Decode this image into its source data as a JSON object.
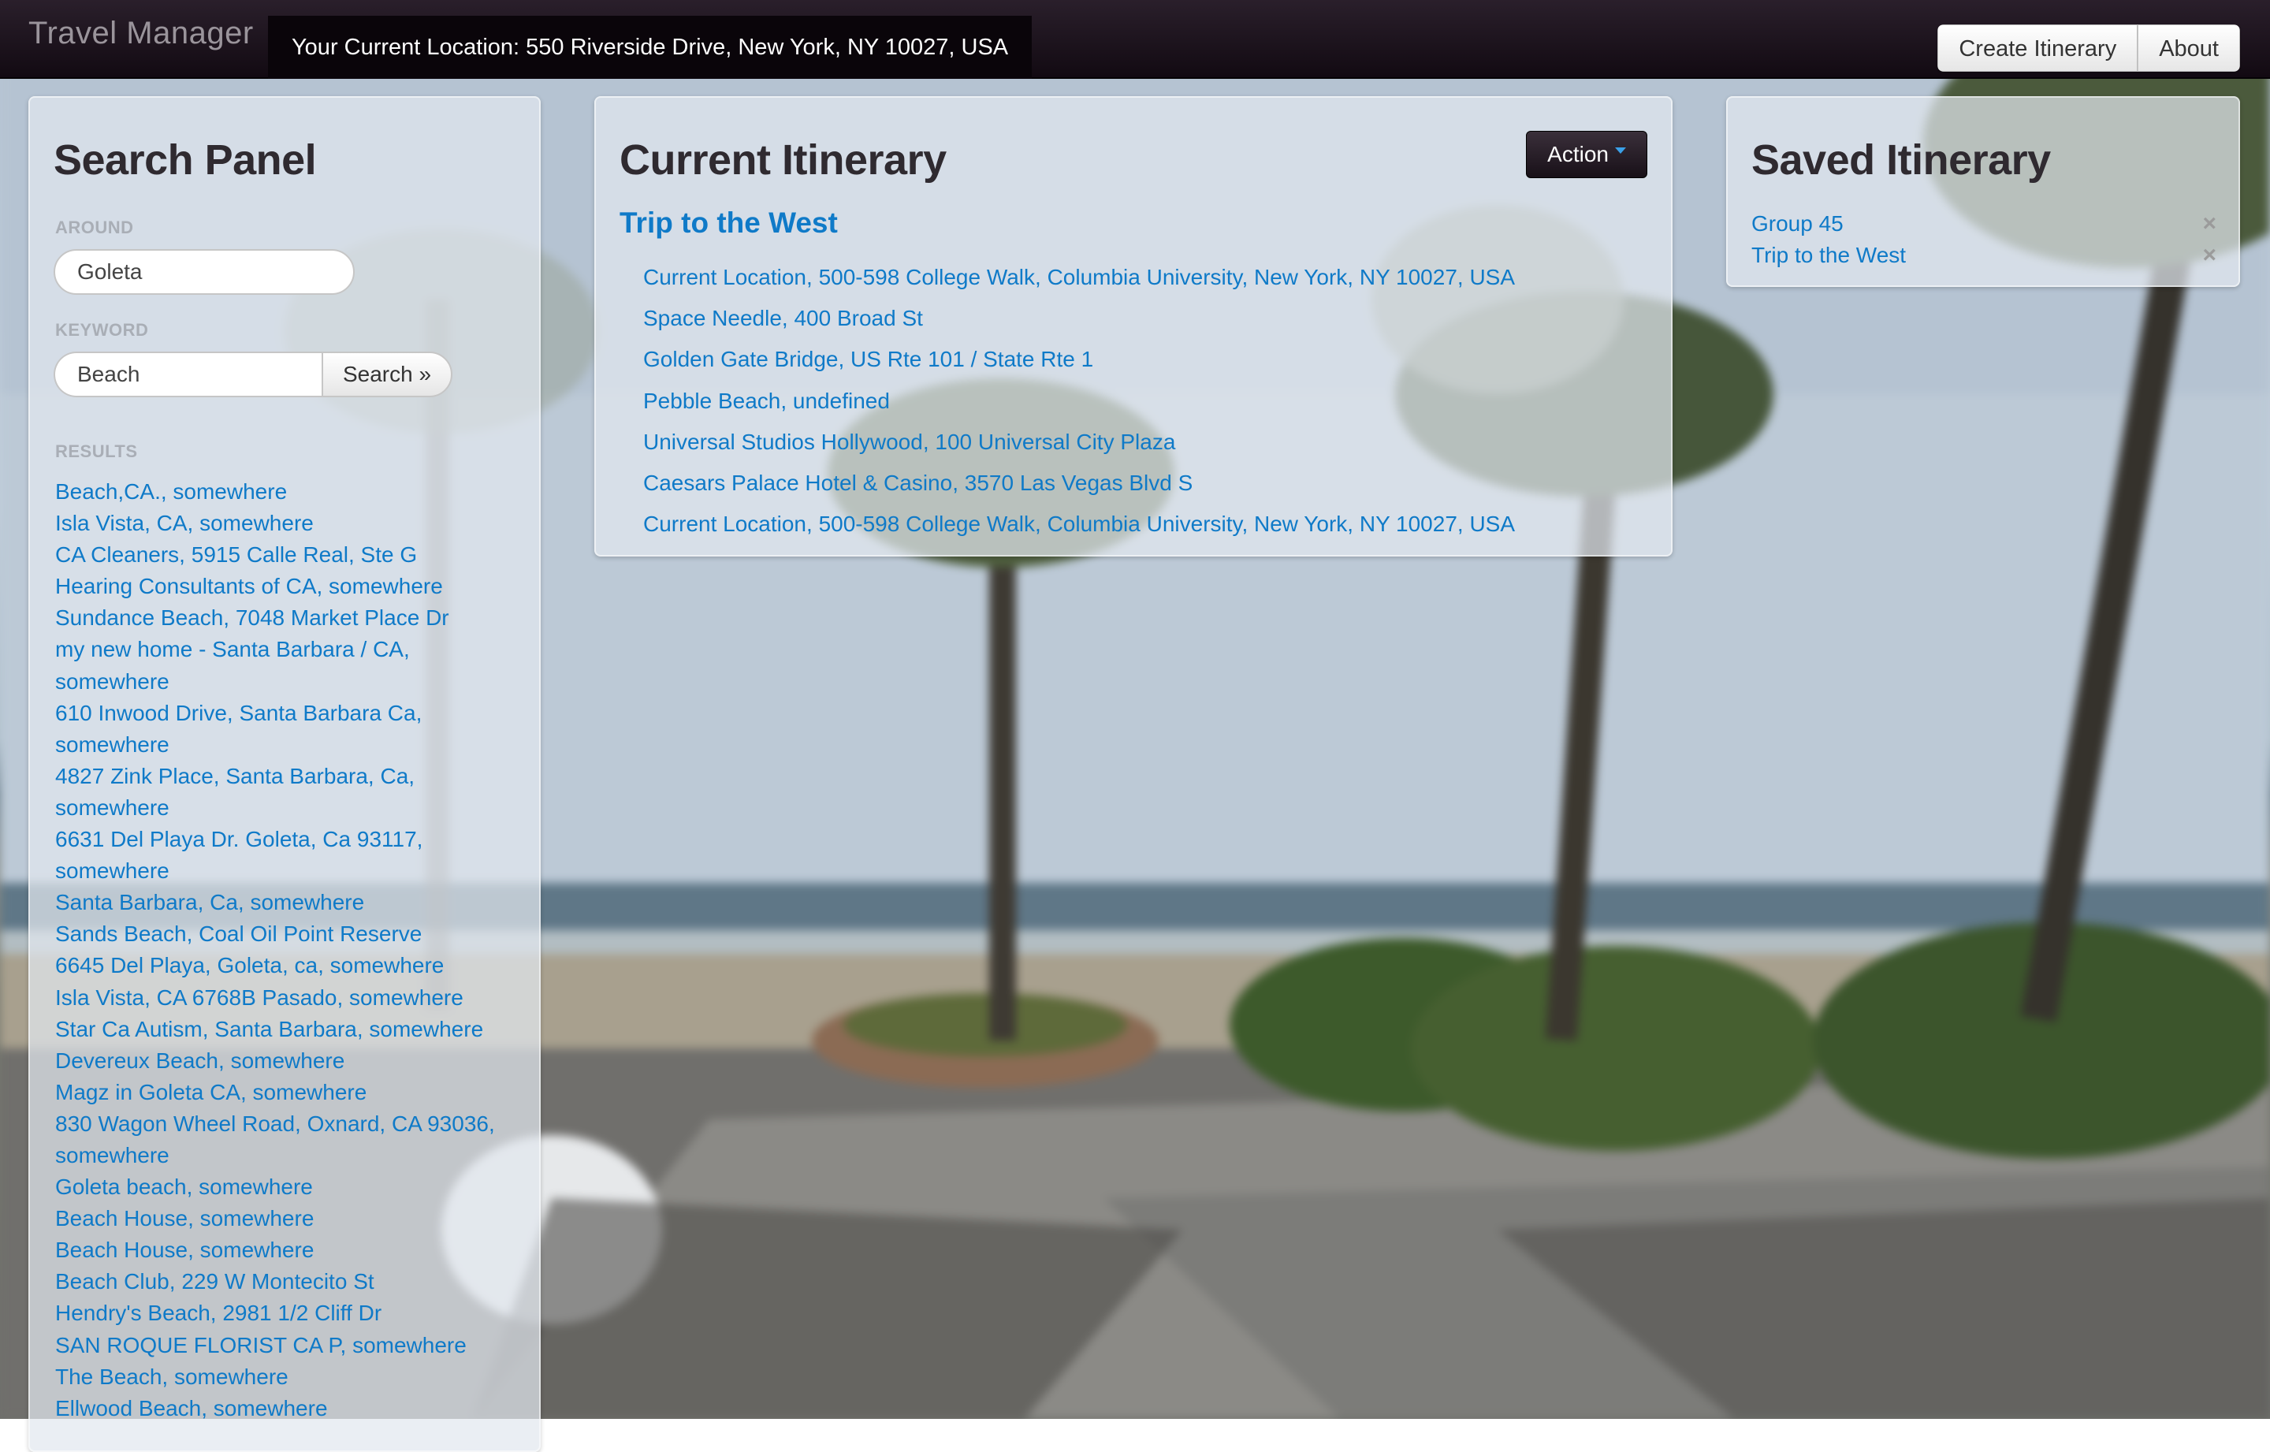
{
  "navbar": {
    "brand": "Travel Manager",
    "location": "Your Current Location: 550 Riverside Drive, New York, NY 10027, USA",
    "buttons": {
      "create_itinerary": "Create Itinerary",
      "about": "About"
    }
  },
  "search_panel": {
    "title": "Search Panel",
    "around_label": "AROUND",
    "around_value": "Goleta",
    "keyword_label": "KEYWORD",
    "keyword_value": "Beach",
    "search_button": "Search »",
    "results_label": "RESULTS",
    "results": [
      "Beach,CA., somewhere",
      "Isla Vista, CA, somewhere",
      "CA Cleaners, 5915 Calle Real, Ste G",
      "Hearing Consultants of CA, somewhere",
      "Sundance Beach, 7048 Market Place Dr",
      "my new home - Santa Barbara / CA, somewhere",
      "610 Inwood Drive, Santa Barbara Ca, somewhere",
      "4827 Zink Place, Santa Barbara, Ca, somewhere",
      "6631 Del Playa Dr. Goleta, Ca 93117, somewhere",
      "Santa Barbara, Ca, somewhere",
      "Sands Beach, Coal Oil Point Reserve",
      "6645 Del Playa, Goleta, ca, somewhere",
      "Isla Vista, CA 6768B Pasado, somewhere",
      "Star Ca Autism, Santa Barbara, somewhere",
      "Devereux Beach, somewhere",
      "Magz in Goleta CA, somewhere",
      "830 Wagon Wheel Road, Oxnard, CA 93036, somewhere",
      "Goleta beach, somewhere",
      "Beach House, somewhere",
      "Beach House, somewhere",
      "Beach Club, 229 W Montecito St",
      "Hendry's Beach, 2981 1/2 Cliff Dr",
      "SAN ROQUE FLORIST CA P, somewhere",
      "The Beach, somewhere",
      "Ellwood Beach, somewhere"
    ]
  },
  "itinerary_panel": {
    "title": "Current Itinerary",
    "action_button": "Action",
    "trip_name": "Trip to the West",
    "stops": [
      "Current Location, 500-598 College Walk, Columbia University, New York, NY 10027, USA",
      "Space Needle, 400 Broad St",
      "Golden Gate Bridge, US Rte 101 / State Rte 1",
      "Pebble Beach, undefined",
      "Universal Studios Hollywood, 100 Universal City Plaza",
      "Caesars Palace Hotel & Casino, 3570 Las Vegas Blvd S",
      "Current Location, 500-598 College Walk, Columbia University, New York, NY 10027, USA"
    ]
  },
  "saved_panel": {
    "title": "Saved Itinerary",
    "items": [
      {
        "name": "Group 45",
        "remove": "×"
      },
      {
        "name": "Trip to the West",
        "remove": "×"
      }
    ]
  }
}
